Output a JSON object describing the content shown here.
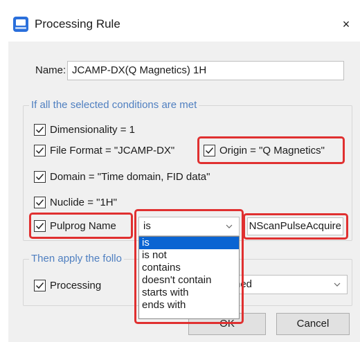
{
  "window": {
    "title": "Processing Rule",
    "close_glyph": "×"
  },
  "name": {
    "label": "Name:",
    "value": "JCAMP-DX(Q Magnetics) 1H"
  },
  "conditions": {
    "group_label": "If all the selected conditions are met",
    "dimensionality": {
      "label": "Dimensionality = 1",
      "checked": true
    },
    "file_format": {
      "label": "File Format = \"JCAMP-DX\"",
      "checked": true
    },
    "origin": {
      "label": "Origin = \"Q Magnetics\"",
      "checked": true
    },
    "domain": {
      "label": "Domain = \"Time domain, FID data\"",
      "checked": true
    },
    "nuclide": {
      "label": "Nuclide = \"1H\"",
      "checked": true
    },
    "pulprog": {
      "label": "Pulprog Name",
      "checked": true,
      "operator": "is",
      "value": "NScanPulseAcquire"
    }
  },
  "operator_options": [
    "is",
    "is not",
    "contains",
    "doesn't contain",
    "starts with",
    "ends with"
  ],
  "selected_operator_index": 0,
  "actions": {
    "group_label": "Then apply the follo",
    "processing": {
      "label": "Processing",
      "checked": true,
      "dropdown_value": "ned"
    }
  },
  "buttons": {
    "ok": "OK",
    "cancel": "Cancel"
  },
  "colors": {
    "highlight": "#e03030",
    "selection": "#0a64d2",
    "group_label": "#4f7fc0"
  },
  "icons": {
    "title": "app-icon",
    "check": "checkmark-icon",
    "dropdown": "chevron-down-icon",
    "close": "close-icon"
  }
}
